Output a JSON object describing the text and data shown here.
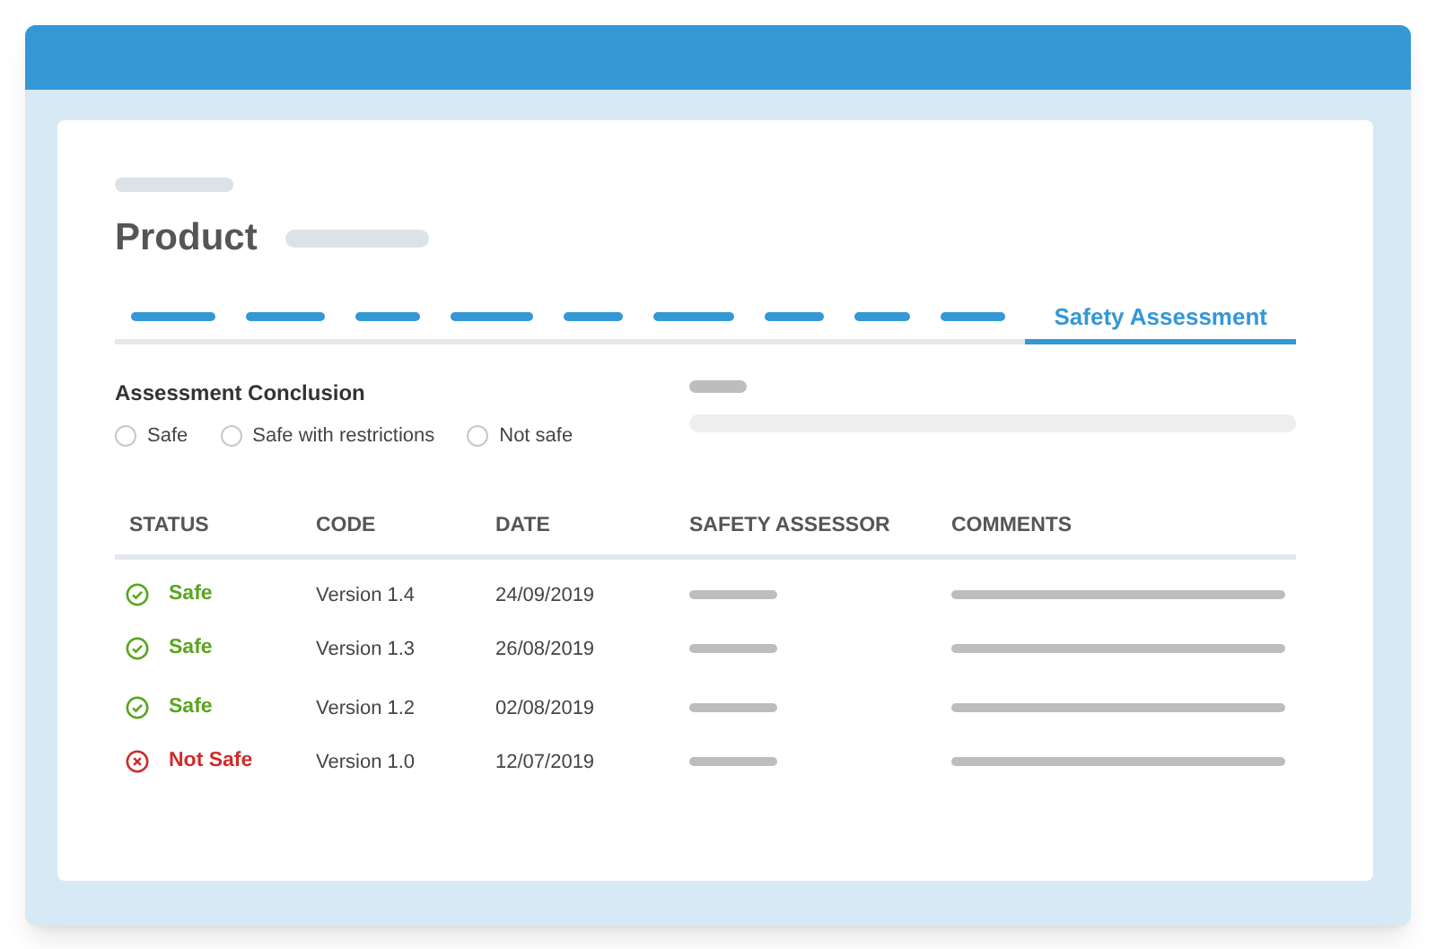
{
  "header": {
    "title": "Product"
  },
  "tabs": [
    {
      "selected": false
    },
    {
      "selected": false
    },
    {
      "selected": false
    },
    {
      "selected": false
    },
    {
      "selected": false
    },
    {
      "selected": false
    },
    {
      "selected": false
    },
    {
      "selected": false
    },
    {
      "selected": false
    },
    {
      "label": "Safety Assessment",
      "selected": true
    }
  ],
  "conclusion": {
    "label": "Assessment Conclusion",
    "options": [
      {
        "label": "Safe",
        "checked": false
      },
      {
        "label": "Safe with restrictions",
        "checked": false
      },
      {
        "label": "Not safe",
        "checked": false
      }
    ]
  },
  "table": {
    "columns": [
      "STATUS",
      "CODE",
      "DATE",
      "SAFETY ASSESSOR",
      "COMMENTS"
    ],
    "rows": [
      {
        "kind": "safe",
        "status": "Safe",
        "code": "Version 1.4",
        "date": "24/09/2019"
      },
      {
        "kind": "safe",
        "status": "Safe",
        "code": "Version 1.3",
        "date": "26/08/2019"
      },
      {
        "kind": "safe",
        "status": "Safe",
        "code": "Version 1.2",
        "date": "02/08/2019"
      },
      {
        "kind": "unsafe",
        "status": "Not Safe",
        "code": "Version 1.0",
        "date": "12/07/2019"
      }
    ]
  }
}
